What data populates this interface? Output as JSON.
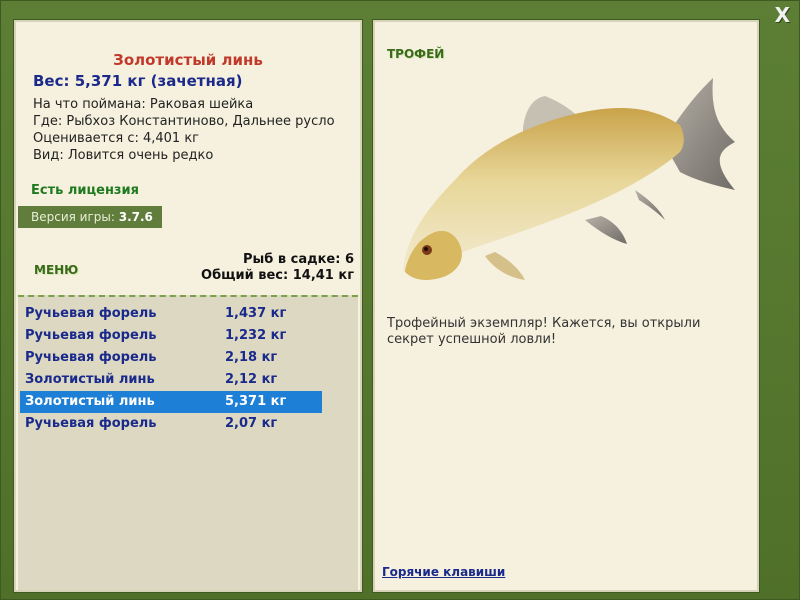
{
  "window": {
    "close_label": "X"
  },
  "fish": {
    "name": "Золотистый линь",
    "weight_line": "Вес: 5,371 кг (зачетная)",
    "bait": "На что поймана: Раковая шейка",
    "location": "Где: Рыбхоз Константиново, Дальнее русло",
    "rated": "Оценивается с: 4,401 кг",
    "kind": "Вид: Ловится очень редко"
  },
  "license": "Есть лицензия",
  "version": {
    "label": "Версия игры:",
    "value": "3.7.6"
  },
  "menu_label": "МЕНЮ",
  "cage": {
    "count": "Рыб в садке: 6",
    "total": "Общий вес: 14,41 кг"
  },
  "catch_list": [
    {
      "name": "Ручьевая форель",
      "weight": "1,437 кг",
      "selected": false
    },
    {
      "name": "Ручьевая форель",
      "weight": "1,232 кг",
      "selected": false
    },
    {
      "name": "Ручьевая форель",
      "weight": "2,18 кг",
      "selected": false
    },
    {
      "name": "Золотистый линь",
      "weight": "2,12 кг",
      "selected": false
    },
    {
      "name": "Золотистый линь",
      "weight": "5,371 кг",
      "selected": true
    },
    {
      "name": "Ручьевая форель",
      "weight": "2,07 кг",
      "selected": false
    }
  ],
  "trophy": {
    "label": "ТРОФЕЙ",
    "message": "Трофейный экземпляр! Кажется, вы открыли секрет успешной ловли!"
  },
  "hotkeys": "Горячие клавиши",
  "colors": {
    "background": "#54762f",
    "panel": "#f5f1de",
    "selected_row": "#1e7fd6",
    "title": "#c0392b"
  }
}
